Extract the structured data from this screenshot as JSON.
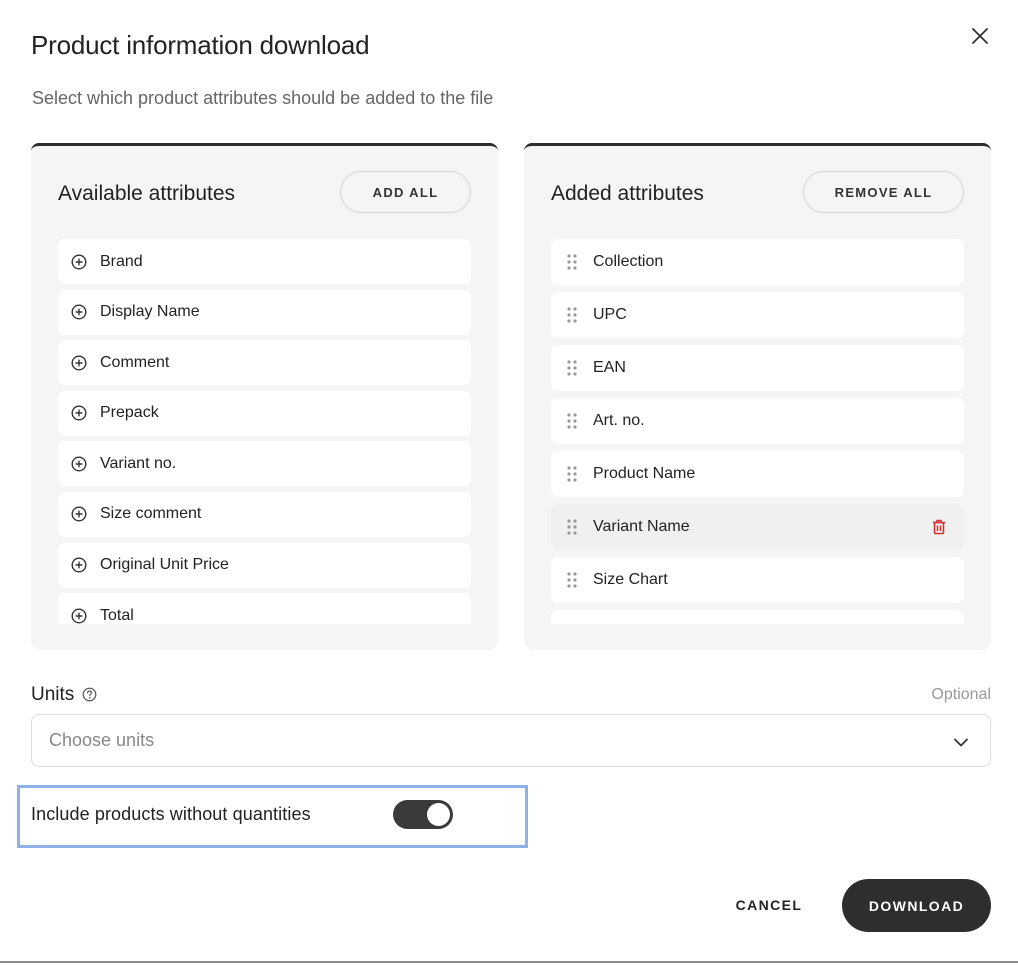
{
  "modal": {
    "title": "Product information download",
    "subtitle": "Select which product attributes should be added to the file"
  },
  "available": {
    "title": "Available attributes",
    "add_all_label": "ADD ALL",
    "items": [
      {
        "label": "Brand"
      },
      {
        "label": "Display Name"
      },
      {
        "label": "Comment"
      },
      {
        "label": "Prepack"
      },
      {
        "label": "Variant no."
      },
      {
        "label": "Size comment"
      },
      {
        "label": "Original Unit Price"
      },
      {
        "label": "Total"
      }
    ]
  },
  "added": {
    "title": "Added attributes",
    "remove_all_label": "REMOVE ALL",
    "items": [
      {
        "label": "Collection"
      },
      {
        "label": "UPC"
      },
      {
        "label": "EAN"
      },
      {
        "label": "Art. no."
      },
      {
        "label": "Product Name"
      },
      {
        "label": "Variant Name"
      },
      {
        "label": "Size Chart"
      }
    ]
  },
  "units": {
    "label": "Units",
    "optional_label": "Optional",
    "placeholder": "Choose units"
  },
  "toggle": {
    "label": "Include products without quantities",
    "on": true
  },
  "actions": {
    "cancel_label": "CANCEL",
    "download_label": "DOWNLOAD"
  },
  "colors": {
    "primary": "#2e2e2e",
    "focus_outline": "#8fb1e8",
    "delete": "#d32f2f",
    "panel_bg": "#f5f5f5"
  }
}
